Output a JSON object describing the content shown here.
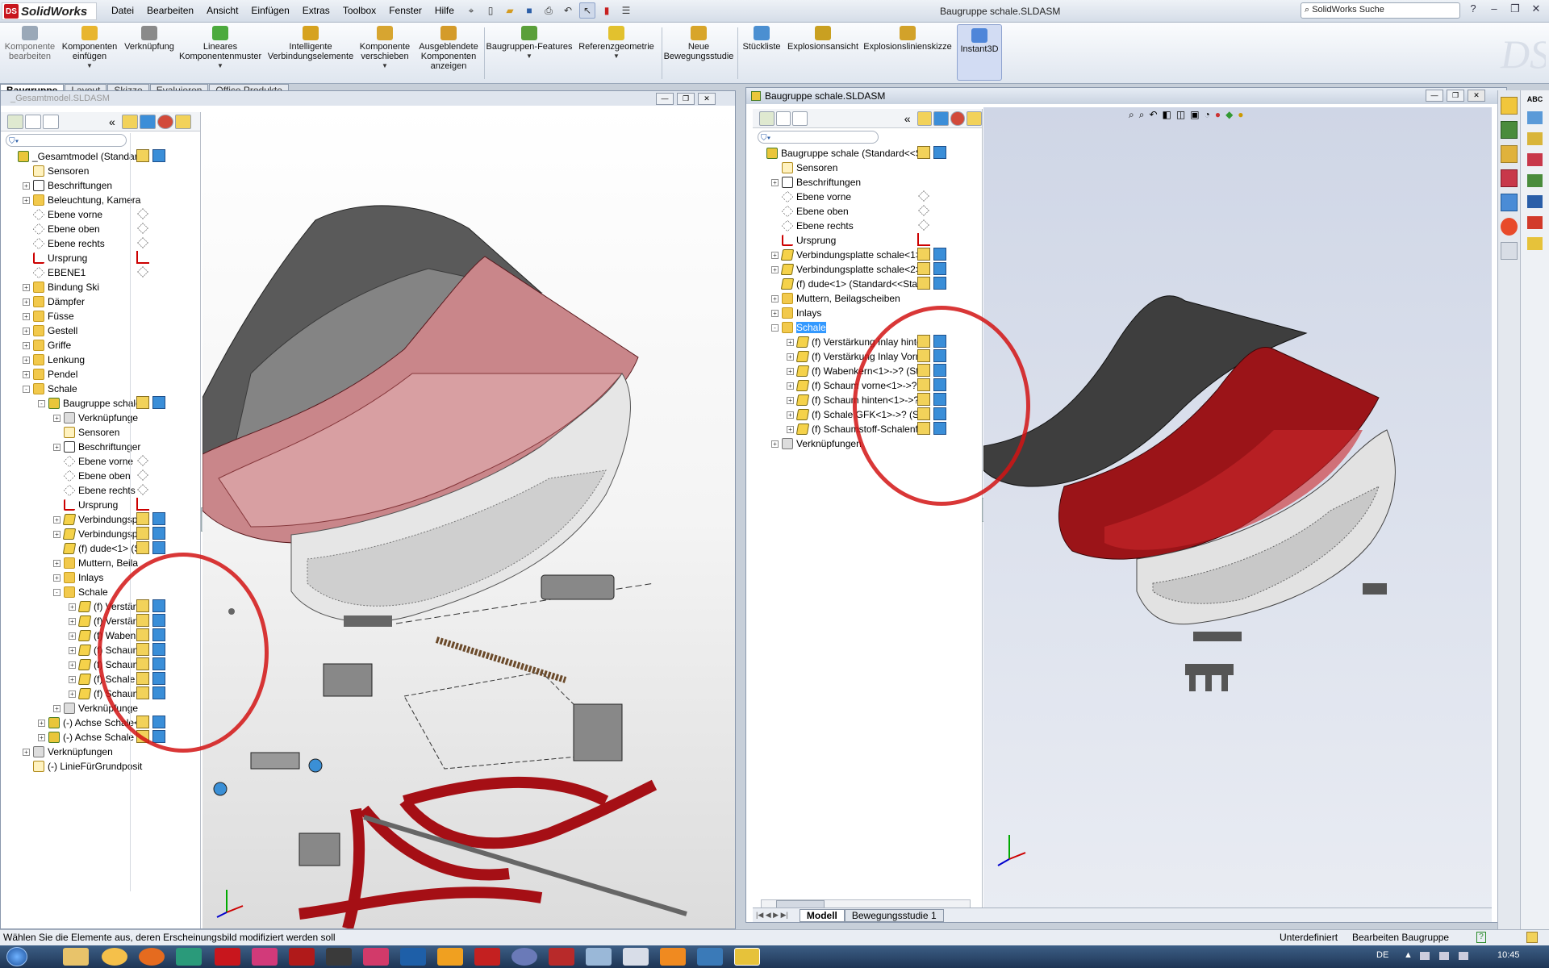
{
  "app": {
    "name": "SolidWorks",
    "logo_text": "DS",
    "doc_title": "Baugruppe schale.SLDASM",
    "search_placeholder": "SolidWorks Suche"
  },
  "menu": [
    "Datei",
    "Bearbeiten",
    "Ansicht",
    "Einfügen",
    "Extras",
    "Toolbox",
    "Fenster",
    "Hilfe"
  ],
  "command_manager": [
    {
      "label": "Komponente bearbeiten",
      "color": "#9aa8b8"
    },
    {
      "label": "Komponenten einfügen",
      "color": "#e8b52f"
    },
    {
      "label": "Verknüpfung",
      "color": "#8a8a8a"
    },
    {
      "label": "Lineares Komponentenmuster",
      "color": "#4caa3e"
    },
    {
      "label": "Intelligente Verbindungselemente",
      "color": "#d6a21f"
    },
    {
      "label": "Komponente verschieben",
      "color": "#d7a530"
    },
    {
      "label": "Ausgeblendete Komponenten anzeigen",
      "color": "#d49b2a"
    },
    {
      "label": "Baugruppen-Features",
      "color": "#5a9f3a"
    },
    {
      "label": "Referenzgeometrie",
      "color": "#e2c12e"
    },
    {
      "label": "Neue Bewegungsstudie",
      "color": "#d8a52a"
    },
    {
      "label": "Stückliste",
      "color": "#4b8fd1"
    },
    {
      "label": "Explosionsansicht",
      "color": "#c9a021"
    },
    {
      "label": "Explosionslinienskizze",
      "color": "#d2a22a"
    },
    {
      "label": "Instant3D",
      "color": "#4f86d9"
    }
  ],
  "tabs": [
    "Baugruppe",
    "Layout",
    "Skizze",
    "Evaluieren",
    "Office Produkte"
  ],
  "left_window": {
    "title": "_Gesamtmodel.SLDASM",
    "tree": [
      {
        "label": "_Gesamtmodel  (Standard<",
        "icon": "asm",
        "level": 0,
        "toggle": ""
      },
      {
        "label": "Sensoren",
        "icon": "sensor",
        "level": 1,
        "toggle": ""
      },
      {
        "label": "Beschriftungen",
        "icon": "annot",
        "level": 1,
        "toggle": "+"
      },
      {
        "label": "Beleuchtung, Kamera",
        "icon": "folder",
        "level": 1,
        "toggle": "+"
      },
      {
        "label": "Ebene vorne",
        "icon": "plane",
        "level": 1,
        "toggle": ""
      },
      {
        "label": "Ebene oben",
        "icon": "plane",
        "level": 1,
        "toggle": ""
      },
      {
        "label": "Ebene rechts",
        "icon": "plane",
        "level": 1,
        "toggle": ""
      },
      {
        "label": "Ursprung",
        "icon": "origin",
        "level": 1,
        "toggle": ""
      },
      {
        "label": "EBENE1",
        "icon": "plane",
        "level": 1,
        "toggle": ""
      },
      {
        "label": "Bindung Ski",
        "icon": "folder",
        "level": 1,
        "toggle": "+"
      },
      {
        "label": "Dämpfer",
        "icon": "folder",
        "level": 1,
        "toggle": "+"
      },
      {
        "label": "Füsse",
        "icon": "folder",
        "level": 1,
        "toggle": "+"
      },
      {
        "label": "Gestell",
        "icon": "folder",
        "level": 1,
        "toggle": "+"
      },
      {
        "label": "Griffe",
        "icon": "folder",
        "level": 1,
        "toggle": "+"
      },
      {
        "label": "Lenkung",
        "icon": "folder",
        "level": 1,
        "toggle": "+"
      },
      {
        "label": "Pendel",
        "icon": "folder",
        "level": 1,
        "toggle": "+"
      },
      {
        "label": "Schale",
        "icon": "folder",
        "level": 1,
        "toggle": "-"
      },
      {
        "label": "Baugruppe schale",
        "icon": "asm",
        "level": 2,
        "toggle": "-"
      },
      {
        "label": "Verknüpfunge",
        "icon": "mates",
        "level": 3,
        "toggle": "+"
      },
      {
        "label": "Sensoren",
        "icon": "sensor",
        "level": 3,
        "toggle": ""
      },
      {
        "label": "Beschriftunger",
        "icon": "annot",
        "level": 3,
        "toggle": "+"
      },
      {
        "label": "Ebene vorne",
        "icon": "plane",
        "level": 3,
        "toggle": ""
      },
      {
        "label": "Ebene oben",
        "icon": "plane",
        "level": 3,
        "toggle": ""
      },
      {
        "label": "Ebene rechts",
        "icon": "plane",
        "level": 3,
        "toggle": ""
      },
      {
        "label": "Ursprung",
        "icon": "origin",
        "level": 3,
        "toggle": ""
      },
      {
        "label": "Verbindungsp",
        "icon": "part",
        "level": 3,
        "toggle": "+"
      },
      {
        "label": "Verbindungsp",
        "icon": "part",
        "level": 3,
        "toggle": "+"
      },
      {
        "label": "(f) dude<1> (S",
        "icon": "part",
        "level": 3,
        "toggle": ""
      },
      {
        "label": "Muttern, Beila",
        "icon": "folder",
        "level": 3,
        "toggle": "+"
      },
      {
        "label": "Inlays",
        "icon": "folder",
        "level": 3,
        "toggle": "+"
      },
      {
        "label": "Schale",
        "icon": "folder",
        "level": 3,
        "toggle": "-"
      },
      {
        "label": "(f) Verstärk",
        "icon": "part",
        "level": 4,
        "toggle": "+"
      },
      {
        "label": "(f) Verstärk",
        "icon": "part",
        "level": 4,
        "toggle": "+"
      },
      {
        "label": "(f) Wabenk",
        "icon": "part",
        "level": 4,
        "toggle": "+"
      },
      {
        "label": "(f) Schaum",
        "icon": "part",
        "level": 4,
        "toggle": "+"
      },
      {
        "label": "(f) Schaum",
        "icon": "part",
        "level": 4,
        "toggle": "+"
      },
      {
        "label": "(f) Schale C",
        "icon": "part",
        "level": 4,
        "toggle": "+"
      },
      {
        "label": "(f) Schaum",
        "icon": "part",
        "level": 4,
        "toggle": "+"
      },
      {
        "label": "Verknüpfunge",
        "icon": "mates",
        "level": 3,
        "toggle": "+"
      },
      {
        "label": "(-) Achse Schale<",
        "icon": "asm",
        "level": 2,
        "toggle": "+"
      },
      {
        "label": "(-) Achse Schale",
        "icon": "asm",
        "level": 2,
        "toggle": "+"
      },
      {
        "label": "Verknüpfungen",
        "icon": "mates",
        "level": 1,
        "toggle": "+"
      },
      {
        "label": "(-) LinieFürGrundposit",
        "icon": "sensor",
        "level": 1,
        "toggle": ""
      }
    ]
  },
  "right_window": {
    "title": "Baugruppe schale.SLDASM",
    "tree": [
      {
        "label": "Baugruppe schale  (Standard<<St",
        "icon": "asm",
        "level": 0,
        "toggle": "",
        "selected": false
      },
      {
        "label": "Sensoren",
        "icon": "sensor",
        "level": 1,
        "toggle": "",
        "selected": false
      },
      {
        "label": "Beschriftungen",
        "icon": "annot",
        "level": 1,
        "toggle": "+",
        "selected": false
      },
      {
        "label": "Ebene vorne",
        "icon": "plane",
        "level": 1,
        "toggle": "",
        "selected": false
      },
      {
        "label": "Ebene oben",
        "icon": "plane",
        "level": 1,
        "toggle": "",
        "selected": false
      },
      {
        "label": "Ebene rechts",
        "icon": "plane",
        "level": 1,
        "toggle": "",
        "selected": false
      },
      {
        "label": "Ursprung",
        "icon": "origin",
        "level": 1,
        "toggle": "",
        "selected": false
      },
      {
        "label": "Verbindungsplatte schale<1>",
        "icon": "part",
        "level": 1,
        "toggle": "+",
        "selected": false
      },
      {
        "label": "Verbindungsplatte schale<2>",
        "icon": "part",
        "level": 1,
        "toggle": "+",
        "selected": false
      },
      {
        "label": "(f) dude<1> (Standard<<Stan",
        "icon": "part",
        "level": 1,
        "toggle": "",
        "selected": false
      },
      {
        "label": "Muttern, Beilagscheiben",
        "icon": "folder",
        "level": 1,
        "toggle": "+",
        "selected": false
      },
      {
        "label": "Inlays",
        "icon": "folder",
        "level": 1,
        "toggle": "+",
        "selected": false
      },
      {
        "label": "Schale",
        "icon": "folder",
        "level": 1,
        "toggle": "-",
        "selected": true
      },
      {
        "label": "(f) Verstärkung Inlay hinter",
        "icon": "part",
        "level": 2,
        "toggle": "+",
        "selected": false
      },
      {
        "label": "(f) Verstärkung Inlay Vorn<",
        "icon": "part",
        "level": 2,
        "toggle": "+",
        "selected": false
      },
      {
        "label": "(f) Wabenkern<1>->? (Sta",
        "icon": "part",
        "level": 2,
        "toggle": "+",
        "selected": false
      },
      {
        "label": "(f) Schaum vorne<1>->? (",
        "icon": "part",
        "level": 2,
        "toggle": "+",
        "selected": false
      },
      {
        "label": "(f) Schaum hinten<1>->?",
        "icon": "part",
        "level": 2,
        "toggle": "+",
        "selected": false
      },
      {
        "label": "(f) Schale GFK<1>->? (Sta",
        "icon": "part",
        "level": 2,
        "toggle": "+",
        "selected": false
      },
      {
        "label": "(f) Schaumstoff-Schalenflä",
        "icon": "part",
        "level": 2,
        "toggle": "+",
        "selected": false
      },
      {
        "label": "Verknüpfungen",
        "icon": "mates",
        "level": 1,
        "toggle": "+",
        "selected": false
      }
    ],
    "bottom_tabs": [
      "Modell",
      "Bewegungsstudie 1"
    ]
  },
  "status": {
    "message": "Wählen Sie die Elemente aus, deren Erscheinungsbild modifiziert werden soll",
    "state": "Unterdefiniert",
    "mode": "Bearbeiten Baugruppe"
  },
  "taskbar": {
    "lang": "DE",
    "time": "10:45"
  },
  "colors": {
    "highlight_circle": "#d21414",
    "shell_red": "#a0151a",
    "shell_gray": "#4b4b4b",
    "frame_red": "#c01018"
  }
}
